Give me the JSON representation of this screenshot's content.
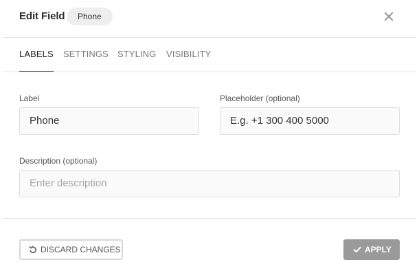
{
  "dialog": {
    "title": "Edit Field",
    "field_type": "Phone",
    "close_icon": "close-icon"
  },
  "tabs": [
    {
      "label": "LABELS",
      "active": true
    },
    {
      "label": "SETTINGS",
      "active": false
    },
    {
      "label": "STYLING",
      "active": false
    },
    {
      "label": "VISIBILITY",
      "active": false
    }
  ],
  "form": {
    "label": {
      "caption": "Label",
      "value": "Phone"
    },
    "placeholder": {
      "caption": "Placeholder (optional)",
      "value": "E.g. +1 300 400 5000"
    },
    "description": {
      "caption": "Description (optional)",
      "value": "",
      "placeholder": "Enter description"
    }
  },
  "footer": {
    "discard_label": "DISCARD CHANGES",
    "discard_icon": "undo-icon",
    "apply_label": "APPLY",
    "apply_icon": "check-icon"
  },
  "colors": {
    "apply_bg": "#9a9a9a",
    "active_tab": "#222222",
    "inactive_tab": "#777777"
  }
}
